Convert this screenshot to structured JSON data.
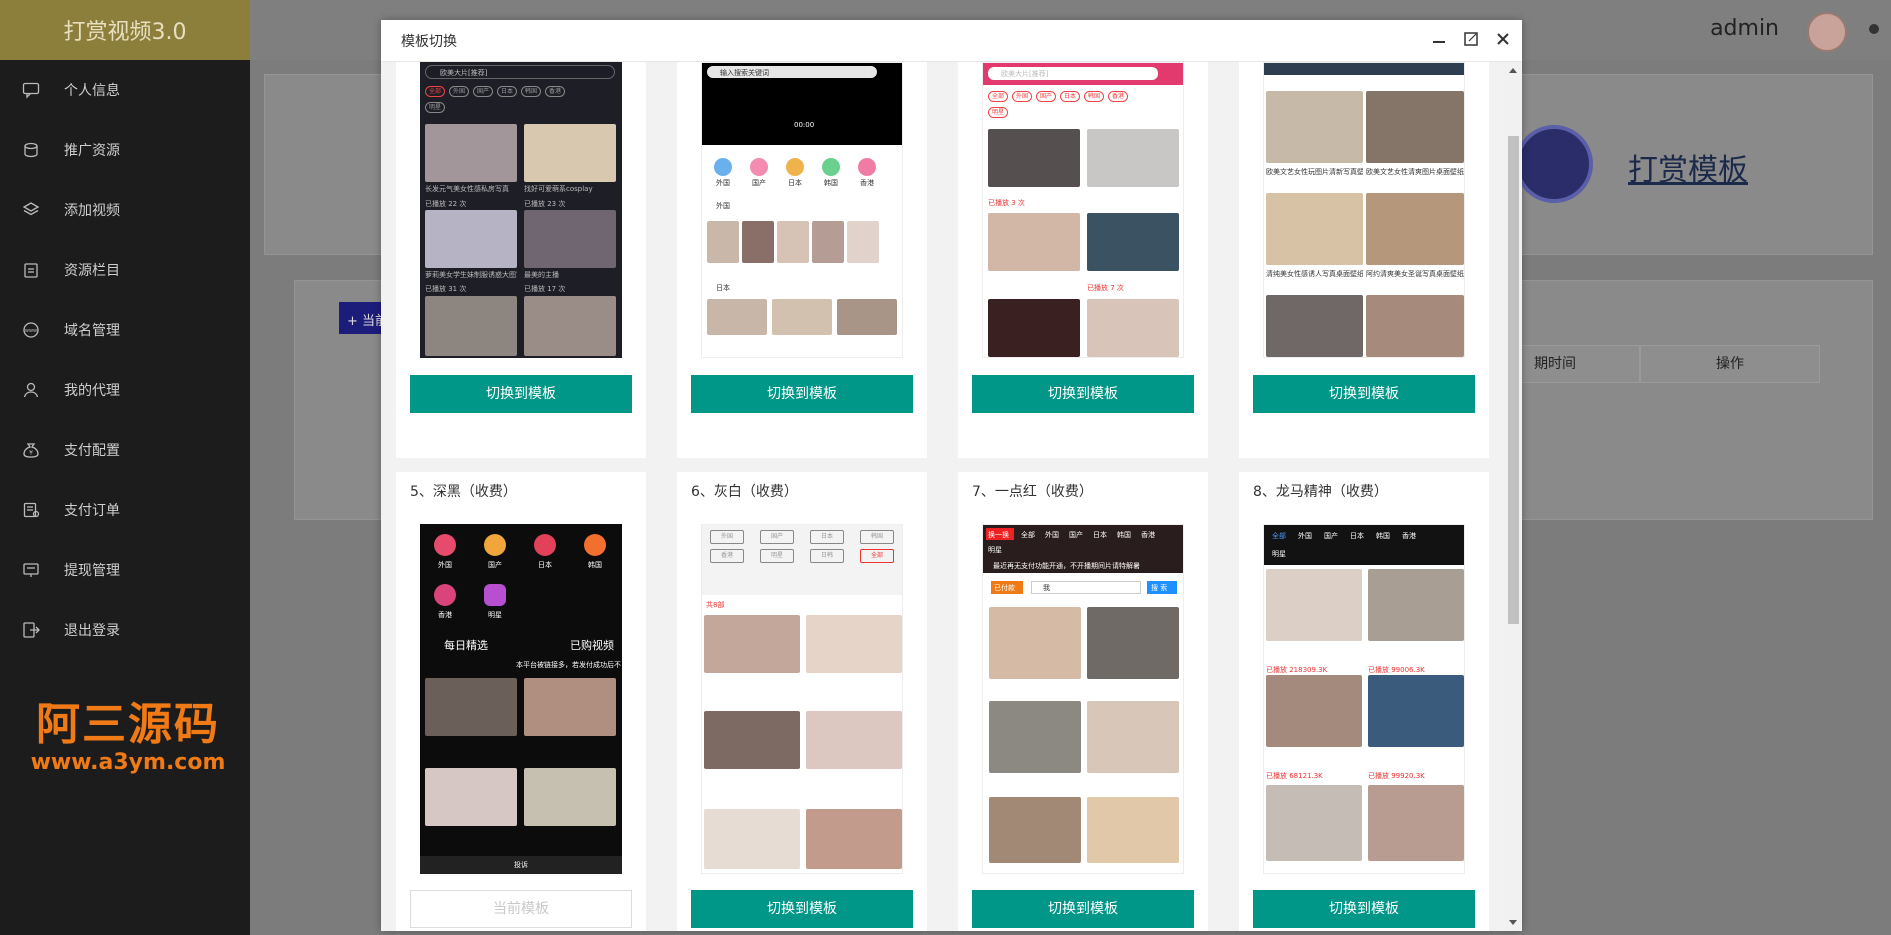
{
  "app": {
    "brand": "打赏视频3.0"
  },
  "sidebar": {
    "items": [
      {
        "label": "个人信息",
        "icon": "message-icon"
      },
      {
        "label": "推广资源",
        "icon": "coins-icon"
      },
      {
        "label": "添加视频",
        "icon": "layers-icon"
      },
      {
        "label": "资源栏目",
        "icon": "clipboard-icon"
      },
      {
        "label": "域名管理",
        "icon": "www-icon"
      },
      {
        "label": "我的代理",
        "icon": "user-icon"
      },
      {
        "label": "支付配置",
        "icon": "money-bag-icon"
      },
      {
        "label": "支付订单",
        "icon": "order-icon"
      },
      {
        "label": "提现管理",
        "icon": "withdraw-icon"
      },
      {
        "label": "退出登录",
        "icon": "logout-icon"
      }
    ]
  },
  "watermark": {
    "line1": "阿三源码",
    "line2": "www.a3ym.com"
  },
  "header": {
    "username": "admin"
  },
  "background": {
    "page_title": "打赏模板",
    "add_button": "+ 当前",
    "col_expire": "期时间",
    "col_action": "操作"
  },
  "modal": {
    "title": "模板切换",
    "switch_label": "切换到模板",
    "current_label": "当前模板",
    "cards": [
      {
        "title": "5、深黑（收费）",
        "current": true
      },
      {
        "title": "6、灰白（收费）",
        "current": false
      },
      {
        "title": "7、一点红（收费）",
        "current": false
      },
      {
        "title": "8、龙马精神（收费）",
        "current": false
      }
    ],
    "top_row_buttons": [
      "切换到模板",
      "切换到模板",
      "切换到模板",
      "切换到模板"
    ]
  },
  "previews": {
    "t1": {
      "search": "欧美大片[推荐]",
      "pills": [
        "全部",
        "外国",
        "国产",
        "日本",
        "韩国",
        "香港",
        "明星"
      ],
      "items": [
        {
          "title": "长发元气美女性感私房写真",
          "views": "已播放 22 次"
        },
        {
          "title": "找好可爱萌系cosplay",
          "views": "已播放 23 次"
        },
        {
          "title": "萝莉美女学生妹制服诱惑大图写真",
          "views": "已播放 31 次"
        },
        {
          "title": "最美的主播",
          "views": "已播放 17 次"
        }
      ]
    },
    "t2": {
      "search": "输入搜索关键词",
      "time": "00:00",
      "cats": [
        "外国",
        "国产",
        "日本",
        "韩国",
        "香港"
      ],
      "sec1": "外国",
      "sec2": "日本"
    },
    "t3": {
      "search": "欧美大片[推荐]",
      "pills": [
        "全部",
        "外国",
        "国产",
        "日本",
        "韩国",
        "香港",
        "明星"
      ],
      "views1": "已播放 3 次",
      "views2": "已播放 7 次"
    },
    "t4": {
      "cap1": "欧美文艺女性玩图片清新写真壁纸",
      "cap2": "欧美文艺女性清爽图片桌面壁纸",
      "cap3": "清纯美女性感诱人写真桌面壁纸",
      "cap4": "阿约清爽美女圣诞写真桌面壁纸"
    },
    "t5": {
      "cats": [
        "外国",
        "国产",
        "日本",
        "韩国",
        "香港",
        "明星"
      ],
      "left_tab": "每日精选",
      "right_tab": "已购视频",
      "notice": "本平台被链接多，若发付成功后不",
      "footer": "投诉"
    },
    "t6": {
      "tabs": [
        "外国",
        "国产",
        "日本",
        "韩国",
        "香港",
        "明星",
        "日韩",
        "全部"
      ],
      "sec": "共8部"
    },
    "t7": {
      "tabs": [
        "换一换",
        "全部",
        "外国",
        "国产",
        "日本",
        "韩国",
        "香港",
        "明星"
      ],
      "notice": "最近再无支付功能开通，不开播期间片请特解暑",
      "paid": "已付款",
      "search": "我",
      "search_btn": "搜 索"
    },
    "t8": {
      "tabs": [
        "全部",
        "外国",
        "国产",
        "日本",
        "韩国",
        "香港",
        "明星"
      ],
      "views1": "已播放 218309.3K",
      "views2": "已播放 99006.3K",
      "views3": "已播放 68121.3K",
      "views4": "已播放 99920.3K"
    }
  },
  "colors": {
    "accent": "#009688",
    "sidebar_bg": "#1c1c1c",
    "brand_bg": "#8c7f3b"
  }
}
